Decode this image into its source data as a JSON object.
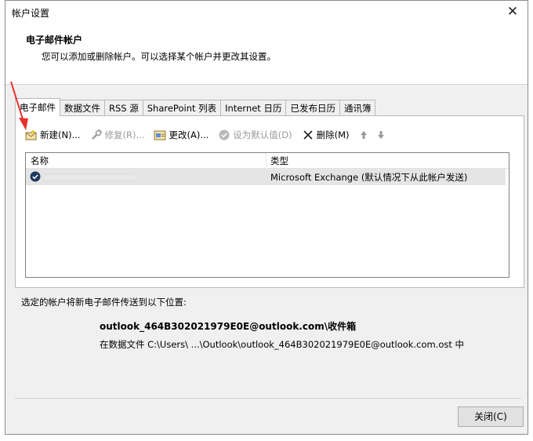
{
  "window": {
    "title": "帐户设置",
    "close_icon": "close-icon"
  },
  "header": {
    "title": "电子邮件帐户",
    "description": "您可以添加或删除帐户。可以选择某个帐户并更改其设置。"
  },
  "tabs": [
    {
      "label": "电子邮件",
      "active": true
    },
    {
      "label": "数据文件"
    },
    {
      "label": "RSS 源"
    },
    {
      "label": "SharePoint 列表"
    },
    {
      "label": "Internet 日历"
    },
    {
      "label": "已发布日历"
    },
    {
      "label": "通讯簿"
    }
  ],
  "toolbar": {
    "new_label": "新建(N)...",
    "repair_label": "修复(R)...",
    "change_label": "更改(A)...",
    "set_default_label": "设为默认值(D)",
    "remove_label": "删除(M)"
  },
  "list": {
    "col_name": "名称",
    "col_type": "类型",
    "rows": [
      {
        "type": "Microsoft Exchange (默认情况下从此帐户发送)"
      }
    ]
  },
  "delivery": {
    "label": "选定的帐户将新电子邮件传送到以下位置:",
    "target": "outlook_464B302021979E0E@outlook.com\\收件箱",
    "path": "在数据文件 C:\\Users\\ ...\\Outlook\\outlook_464B302021979E0E@outlook.com.ost 中"
  },
  "footer": {
    "close_label": "关闭(C)"
  },
  "colors": {
    "annotation_arrow": "#e8312d",
    "check_circle": "#1f3a5f"
  }
}
